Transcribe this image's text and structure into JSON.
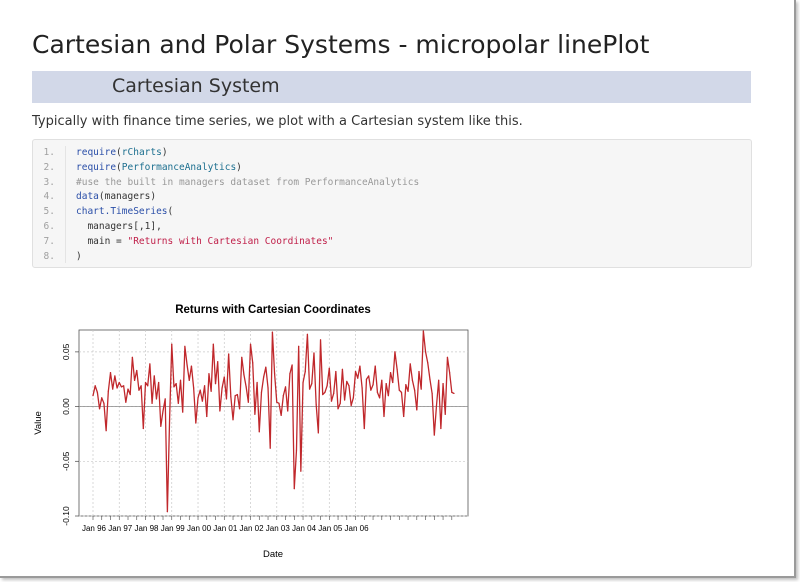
{
  "page": {
    "title": "Cartesian and Polar Systems - micropolar linePlot",
    "section_title": "Cartesian System",
    "intro": "Typically with finance time series, we plot with a Cartesian system like this."
  },
  "code": {
    "lines": [
      {
        "n": "1.",
        "parts": [
          {
            "t": "require",
            "c": "fn"
          },
          {
            "t": "(",
            "c": ""
          },
          {
            "t": "rCharts",
            "c": "id"
          },
          {
            "t": ")",
            "c": ""
          }
        ]
      },
      {
        "n": "2.",
        "parts": [
          {
            "t": "require",
            "c": "fn"
          },
          {
            "t": "(",
            "c": ""
          },
          {
            "t": "PerformanceAnalytics",
            "c": "id"
          },
          {
            "t": ")",
            "c": ""
          }
        ]
      },
      {
        "n": "3.",
        "parts": [
          {
            "t": "#use the built in managers dataset from PerformanceAnalytics",
            "c": "comment"
          }
        ]
      },
      {
        "n": "4.",
        "parts": [
          {
            "t": "data",
            "c": "fn"
          },
          {
            "t": "(managers)",
            "c": ""
          }
        ]
      },
      {
        "n": "5.",
        "parts": [
          {
            "t": "chart.TimeSeries",
            "c": "fn"
          },
          {
            "t": "(",
            "c": ""
          }
        ]
      },
      {
        "n": "6.",
        "parts": [
          {
            "t": "  managers[,1],",
            "c": ""
          }
        ]
      },
      {
        "n": "7.",
        "parts": [
          {
            "t": "  main = ",
            "c": ""
          },
          {
            "t": "\"Returns with Cartesian Coordinates\"",
            "c": "str"
          }
        ]
      },
      {
        "n": "8.",
        "parts": [
          {
            "t": ")",
            "c": ""
          }
        ]
      }
    ]
  },
  "chart_data": {
    "type": "line",
    "title": "Returns with Cartesian Coordinates",
    "xlabel": "Date",
    "ylabel": "Value",
    "ylim": [
      -0.1,
      0.07
    ],
    "yticks": [
      0.05,
      0.0,
      -0.05,
      -0.1
    ],
    "ytick_labels": [
      "0.05",
      "0.00",
      "-0.05",
      "-0.10"
    ],
    "xtick_labels": [
      "Jan 96",
      "Jan 97",
      "Jan 98",
      "Jan 99",
      "Jan 00",
      "Jan 01",
      "Jan 02",
      "Jan 03",
      "Jan 04",
      "Jan 05",
      "Jan 06"
    ],
    "x_start": "Jan 1996",
    "grid": true,
    "line_color": "#c0282c",
    "series": [
      {
        "values": [
          0.01,
          0.019,
          0.013,
          -0.002,
          0.008,
          0.003,
          -0.022,
          0.014,
          0.031,
          0.016,
          0.028,
          0.017,
          0.022,
          0.018,
          0.019,
          0.004,
          0.016,
          0.011,
          0.045,
          0.024,
          0.033,
          0.015,
          0.019,
          -0.02,
          0.022,
          0.019,
          0.039,
          0.003,
          0.028,
          0.007,
          0.022,
          -0.018,
          -0.004,
          0.007,
          -0.096,
          -0.012,
          0.057,
          0.018,
          0.021,
          0.003,
          0.024,
          -0.005,
          0.055,
          0.038,
          0.024,
          0.037,
          0.017,
          -0.015,
          0.008,
          0.015,
          0.005,
          0.019,
          -0.009,
          0.03,
          0.014,
          0.057,
          0.021,
          0.041,
          -0.004,
          0.017,
          0.027,
          0.007,
          0.048,
          0.009,
          -0.012,
          0.01,
          0.011,
          -0.002,
          0.045,
          0.029,
          0.018,
          0.004,
          0.057,
          0.04,
          -0.007,
          0.022,
          -0.023,
          0.013,
          0.027,
          0.036,
          0.017,
          -0.038,
          0.068,
          0.03,
          0.004,
          0.003,
          -0.008,
          0.01,
          0.018,
          -0.004,
          0.03,
          0.038,
          -0.075,
          -0.04,
          0.055,
          -0.059,
          0.022,
          0.032,
          0.066,
          0.016,
          0.021,
          0.049,
          0.002,
          -0.024,
          0.061,
          0.011,
          0.013,
          0.019,
          0.035,
          0.005,
          0.012,
          0.032,
          -0.002,
          0.003,
          0.034,
          0.006,
          0.023,
          0.019,
          0.001,
          0.008,
          0.032,
          0.026,
          0.037,
          0.017,
          -0.02,
          0.025,
          0.028,
          0.015,
          0.02,
          0.037,
          0.013,
          0.008,
          0.024,
          -0.009,
          0.021,
          0.01,
          0.031,
          0.022,
          0.05,
          0.034,
          0.015,
          0.013,
          -0.009,
          0.02,
          0.014,
          0.039,
          0.024,
          0.015,
          -0.003,
          0.032,
          0.016,
          0.069,
          0.05,
          0.04,
          0.025,
          0.012,
          -0.026,
          0.001,
          0.024,
          -0.02,
          0.021,
          -0.007,
          0.045,
          0.031,
          0.013,
          0.012
        ]
      }
    ]
  }
}
